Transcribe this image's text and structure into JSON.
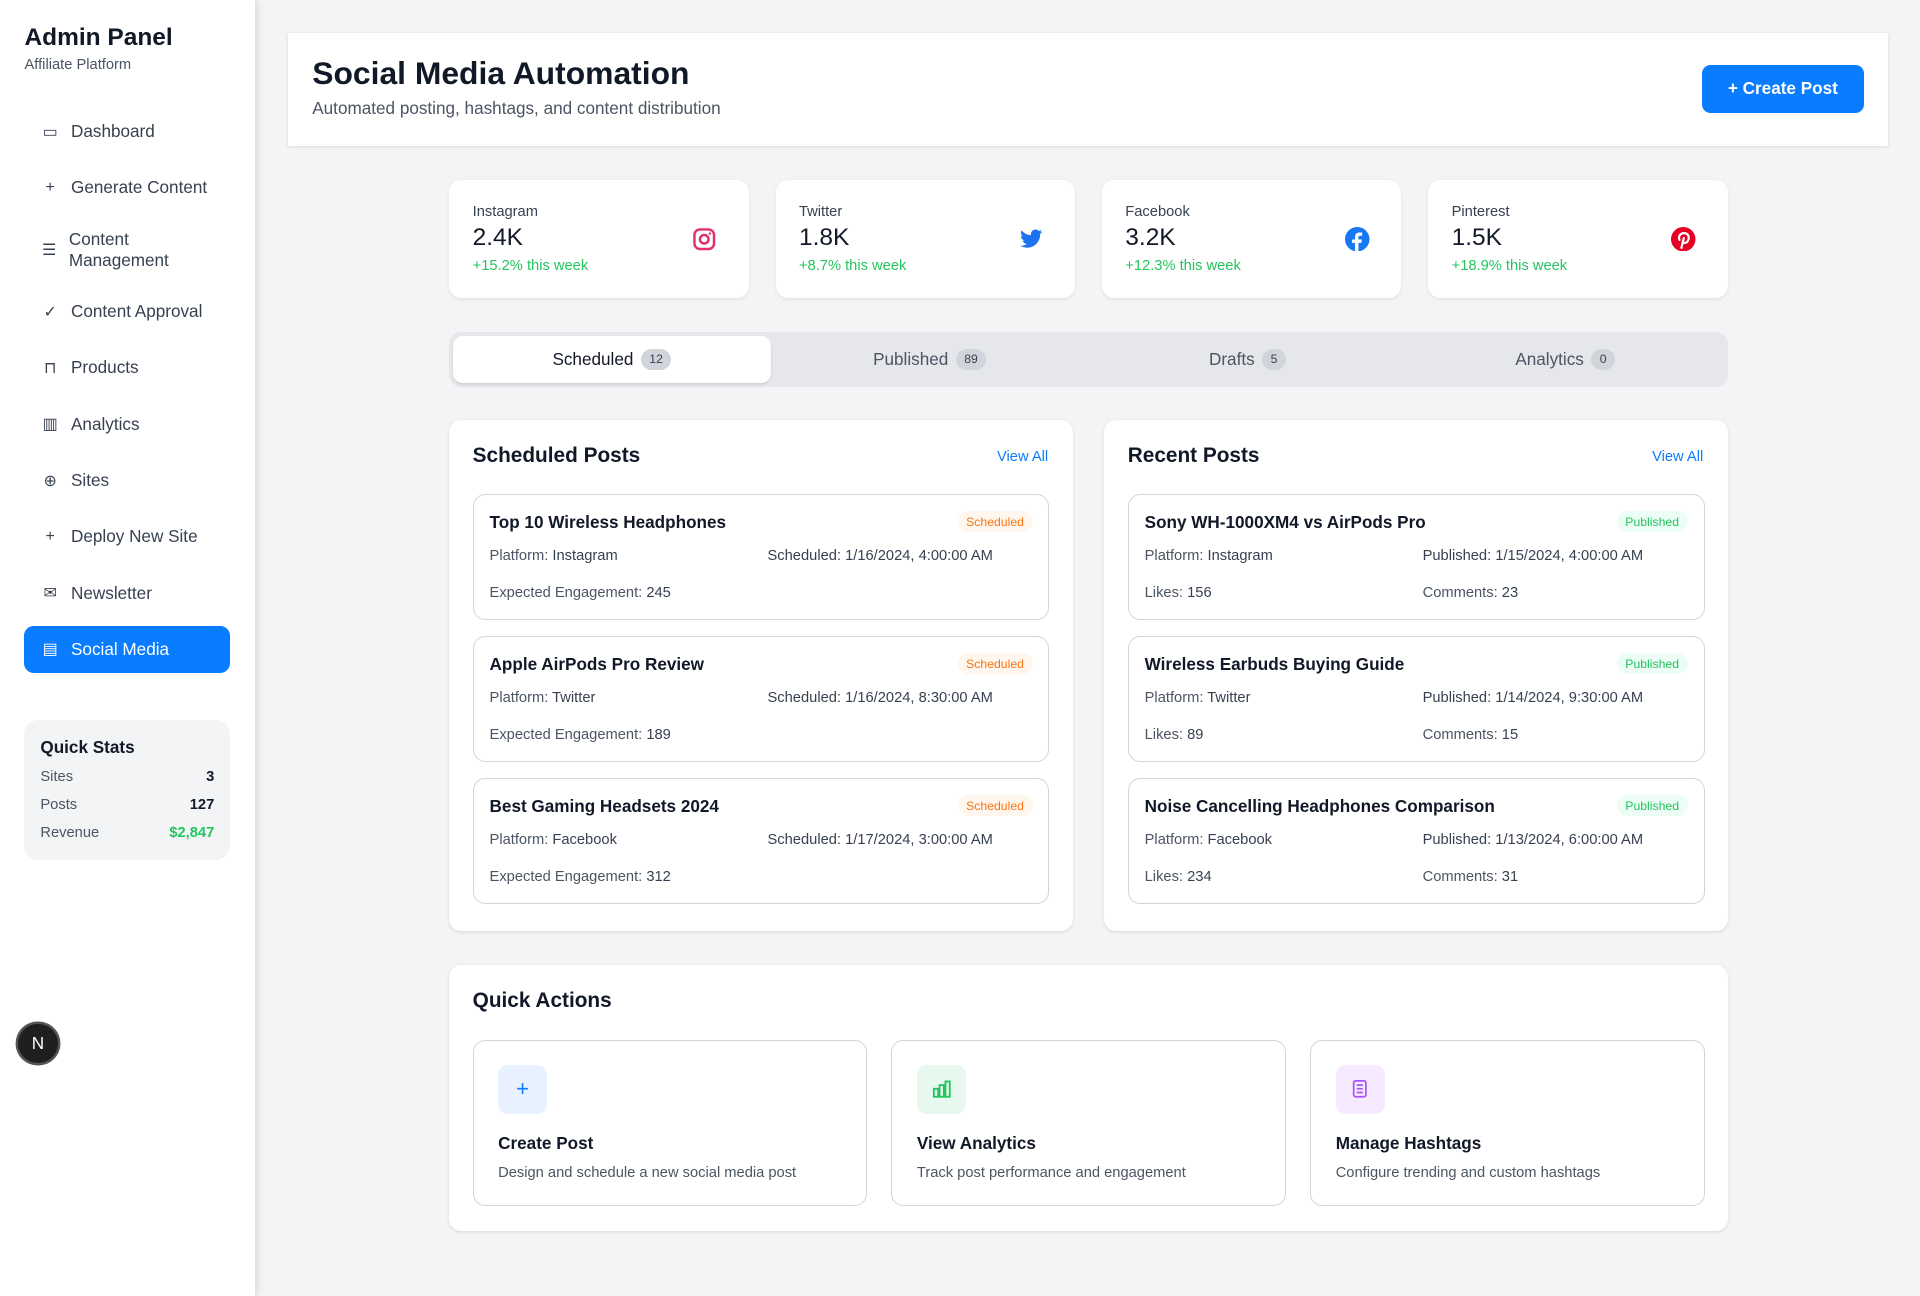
{
  "sidebar": {
    "title": "Admin Panel",
    "subtitle": "Affiliate Platform",
    "items": [
      {
        "label": "Dashboard"
      },
      {
        "label": "Generate Content"
      },
      {
        "label": "Content Management"
      },
      {
        "label": "Content Approval"
      },
      {
        "label": "Products"
      },
      {
        "label": "Analytics"
      },
      {
        "label": "Sites"
      },
      {
        "label": "Deploy New Site"
      },
      {
        "label": "Newsletter"
      },
      {
        "label": "Social Media"
      }
    ],
    "quick_stats": {
      "title": "Quick Stats",
      "rows": [
        {
          "label": "Sites",
          "value": "3"
        },
        {
          "label": "Posts",
          "value": "127"
        },
        {
          "label": "Revenue",
          "value": "$2,847"
        }
      ]
    },
    "avatar_letter": "N"
  },
  "header": {
    "title": "Social Media Automation",
    "subtitle": "Automated posting, hashtags, and content distribution",
    "create_button": "+  Create Post"
  },
  "stats": [
    {
      "label": "Instagram",
      "value": "2.4K",
      "change": "+15.2% this week",
      "color": "#e1306c"
    },
    {
      "label": "Twitter",
      "value": "1.8K",
      "change": "+8.7% this week",
      "color": "#1d9bf0"
    },
    {
      "label": "Facebook",
      "value": "3.2K",
      "change": "+12.3% this week",
      "color": "#1877f2"
    },
    {
      "label": "Pinterest",
      "value": "1.5K",
      "change": "+18.9% this week",
      "color": "#e60023"
    }
  ],
  "tabs": [
    {
      "label": "Scheduled",
      "count": "12"
    },
    {
      "label": "Published",
      "count": "89"
    },
    {
      "label": "Drafts",
      "count": "5"
    },
    {
      "label": "Analytics",
      "count": "0"
    }
  ],
  "scheduled": {
    "title": "Scheduled Posts",
    "view_all": "View All",
    "posts": [
      {
        "title": "Top 10 Wireless Headphones",
        "status": "Scheduled",
        "platform": "Instagram",
        "time": "1/16/2024, 4:00:00 AM",
        "engagement": "245"
      },
      {
        "title": "Apple AirPods Pro Review",
        "status": "Scheduled",
        "platform": "Twitter",
        "time": "1/16/2024, 8:30:00 AM",
        "engagement": "189"
      },
      {
        "title": "Best Gaming Headsets 2024",
        "status": "Scheduled",
        "platform": "Facebook",
        "time": "1/17/2024, 3:00:00 AM",
        "engagement": "312"
      }
    ]
  },
  "recent": {
    "title": "Recent Posts",
    "view_all": "View All",
    "posts": [
      {
        "title": "Sony WH-1000XM4 vs AirPods Pro",
        "status": "Published",
        "platform": "Instagram",
        "time": "1/15/2024, 4:00:00 AM",
        "likes": "156",
        "comments": "23"
      },
      {
        "title": "Wireless Earbuds Buying Guide",
        "status": "Published",
        "platform": "Twitter",
        "time": "1/14/2024, 9:30:00 AM",
        "likes": "89",
        "comments": "15"
      },
      {
        "title": "Noise Cancelling Headphones Comparison",
        "status": "Published",
        "platform": "Facebook",
        "time": "1/13/2024, 6:00:00 AM",
        "likes": "234",
        "comments": "31"
      }
    ]
  },
  "labels": {
    "platform": "Platform:",
    "scheduled": "Scheduled:",
    "published": "Published:",
    "expected": "Expected Engagement:",
    "likes": "Likes:",
    "comments": "Comments:"
  },
  "quick_actions": {
    "title": "Quick Actions",
    "items": [
      {
        "title": "Create Post",
        "desc": "Design and schedule a new social media post"
      },
      {
        "title": "View Analytics",
        "desc": "Track post performance and engagement"
      },
      {
        "title": "Manage Hashtags",
        "desc": "Configure trending and custom hashtags"
      }
    ]
  }
}
